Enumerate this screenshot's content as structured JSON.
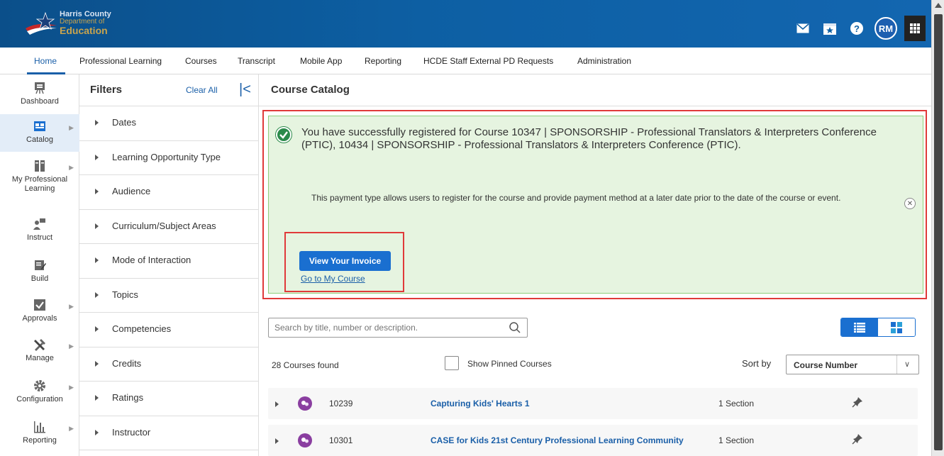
{
  "header": {
    "logo_line1": "Harris County",
    "logo_line2": "Department of",
    "logo_line3": "Education",
    "avatar_initials": "RM",
    "icons": [
      "mail-icon",
      "calendar-star-icon",
      "help-icon",
      "apps-grid-icon"
    ]
  },
  "nav": {
    "tabs": [
      {
        "label": "Home"
      },
      {
        "label": "Professional Learning"
      },
      {
        "label": "Courses"
      },
      {
        "label": "Transcript"
      },
      {
        "label": "Mobile App"
      },
      {
        "label": "Reporting"
      },
      {
        "label": "HCDE Staff External PD Requests"
      },
      {
        "label": "Administration"
      }
    ],
    "active_tab": "Home"
  },
  "rail": {
    "items": [
      {
        "label": "Dashboard",
        "icon": "dashboard-icon"
      },
      {
        "label": "Catalog",
        "icon": "catalog-icon"
      },
      {
        "label": "My Professional Learning",
        "icon": "books-icon"
      },
      {
        "label": "Instruct",
        "icon": "instruct-icon"
      },
      {
        "label": "Build",
        "icon": "build-icon"
      },
      {
        "label": "Approvals",
        "icon": "approvals-icon"
      },
      {
        "label": "Manage",
        "icon": "tools-icon"
      },
      {
        "label": "Configuration",
        "icon": "gear-icon"
      },
      {
        "label": "Reporting",
        "icon": "bar-chart-icon"
      }
    ],
    "active": "Catalog"
  },
  "filters": {
    "title": "Filters",
    "clear_all": "Clear All",
    "items": [
      {
        "label": "Dates"
      },
      {
        "label": "Learning Opportunity Type"
      },
      {
        "label": "Audience"
      },
      {
        "label": "Curriculum/Subject Areas"
      },
      {
        "label": "Mode of Interaction"
      },
      {
        "label": "Topics"
      },
      {
        "label": "Competencies"
      },
      {
        "label": "Credits"
      },
      {
        "label": "Ratings"
      },
      {
        "label": "Instructor"
      }
    ]
  },
  "main": {
    "title": "Course Catalog",
    "alert": {
      "message": "You have successfully registered for Course 10347 | SPONSORSHIP - Professional Translators & Interpreters Conference (PTIC), 10434 | SPONSORSHIP - Professional Translators & Interpreters Conference (PTIC).",
      "sub": "This payment type allows users to register for the course and provide payment method at a later date prior to the date of the course or event.",
      "invoice_button": "View Your Invoice",
      "course_link": "Go to My Course"
    },
    "search": {
      "placeholder": "Search by title, number or description."
    },
    "results": {
      "found": "28 Courses found",
      "show_pinned": "Show Pinned Courses",
      "sort_by_label": "Sort by",
      "sort_value": "Course Number"
    },
    "courses": [
      {
        "number": "10239",
        "title": "Capturing Kids' Hearts 1",
        "sections": "1 Section"
      },
      {
        "number": "10301",
        "title": "CASE for Kids 21st Century Professional Learning Community",
        "sections": "1 Section"
      }
    ]
  },
  "colors": {
    "brand_blue": "#0d5fa3",
    "link_blue": "#1a5fa8",
    "success_bg": "#e6f4e0",
    "highlight_red": "#e03a3a",
    "course_badge": "#8a3ea0"
  }
}
